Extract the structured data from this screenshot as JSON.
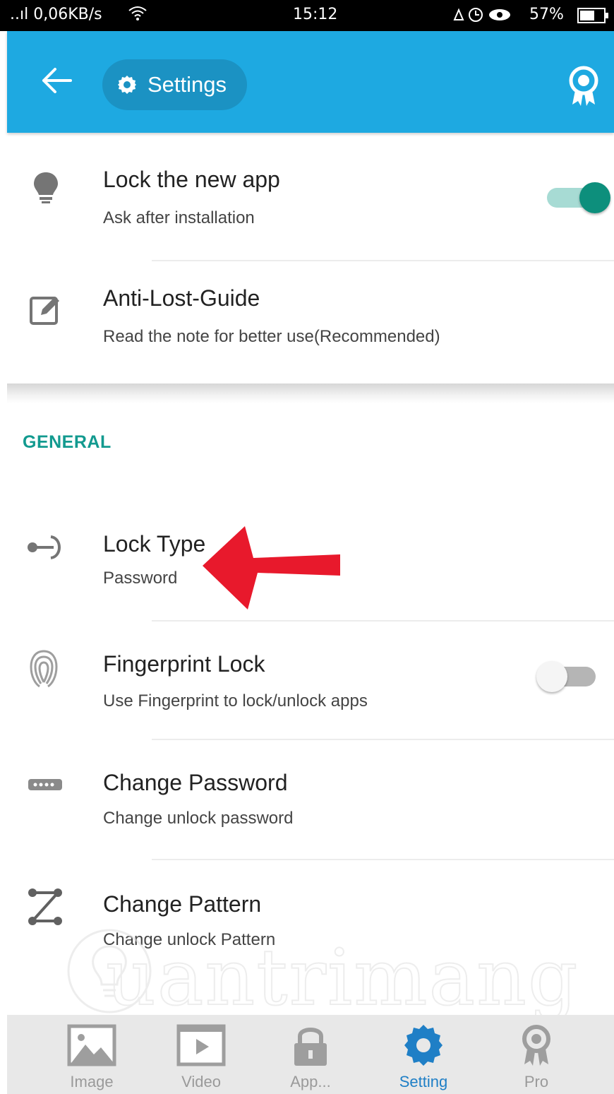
{
  "status_bar": {
    "signal_speed": "..ıl 0,06KB/s",
    "time": "15:12",
    "battery": "57%"
  },
  "app_bar": {
    "title": "Settings",
    "back_icon": "arrow-left-icon",
    "title_icon": "gear-icon",
    "action_icon": "award-ribbon-icon",
    "color": "#1ea9e1"
  },
  "top_items": [
    {
      "title": "Lock the new app",
      "subtitle": "Ask after installation",
      "icon": "lightbulb-icon",
      "toggle": true
    },
    {
      "title": "Anti-Lost-Guide",
      "subtitle": "Read the note for better use(Recommended)",
      "icon": "edit-note-icon"
    }
  ],
  "section_general": "GENERAL",
  "general_items": [
    {
      "title": "Lock Type",
      "subtitle": "Password",
      "icon": "key-icon"
    },
    {
      "title": "Fingerprint Lock",
      "subtitle": "Use Fingerprint to lock/unlock apps",
      "icon": "fingerprint-icon",
      "toggle": false
    },
    {
      "title": "Change Password",
      "subtitle": "Change unlock password",
      "icon": "password-dots-icon"
    },
    {
      "title": "Change Pattern",
      "subtitle": "Change unlock Pattern",
      "icon": "pattern-icon"
    }
  ],
  "annotation": {
    "arrow_color": "#e8192c"
  },
  "watermark": "uantrimang",
  "bottom_nav": [
    {
      "label": "Image",
      "icon": "image-icon",
      "active": false
    },
    {
      "label": "Video",
      "icon": "video-icon",
      "active": false
    },
    {
      "label": "App...",
      "icon": "lock-icon",
      "active": false
    },
    {
      "label": "Setting",
      "icon": "gear-icon",
      "active": true
    },
    {
      "label": "Pro",
      "icon": "award-ribbon-icon",
      "active": false
    }
  ],
  "colors": {
    "accent": "#1ea9e1",
    "toggle_on": "#0d8f7c",
    "section": "#129a8f",
    "active_tab": "#1f7fc6"
  }
}
